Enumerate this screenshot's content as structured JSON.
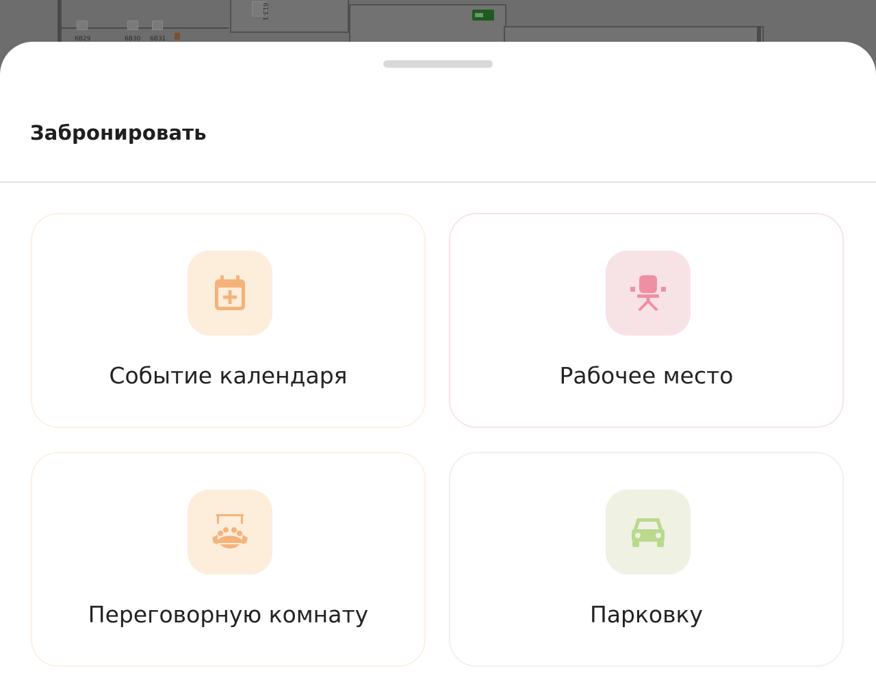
{
  "background_plan": {
    "seat_labels": [
      "6В29",
      "6В30",
      "6В31"
    ],
    "room_label": "613-1"
  },
  "sheet": {
    "title": "Забронировать"
  },
  "options": [
    {
      "label": "Событие календаря",
      "icon": "calendar-plus-icon",
      "accent": "#f5b37a",
      "tile_bg": "#fdeddb"
    },
    {
      "label": "Рабочее место",
      "icon": "office-chair-icon",
      "accent": "#ef8fa3",
      "tile_bg": "#f7e2e6"
    },
    {
      "label": "Переговорную комнату",
      "icon": "meeting-room-icon",
      "accent": "#f5b37a",
      "tile_bg": "#fdeddb"
    },
    {
      "label": "Парковку",
      "icon": "car-icon",
      "accent": "#b9d98c",
      "tile_bg": "#eff1e3"
    }
  ]
}
